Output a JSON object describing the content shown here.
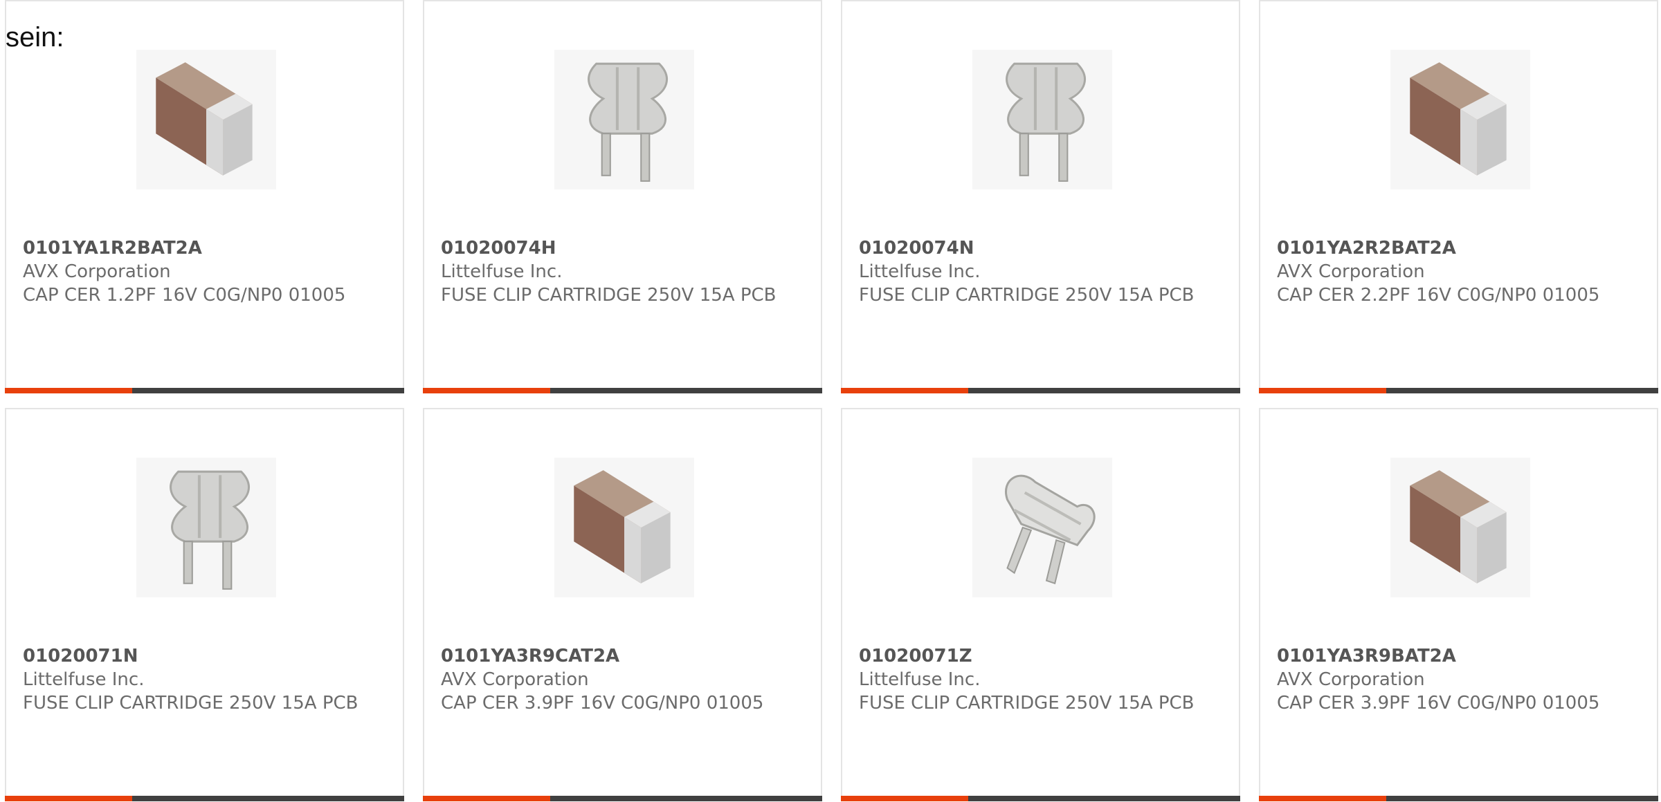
{
  "intro_text": "sein:",
  "colors": {
    "accent": "#e8400c",
    "bar": "#404040",
    "border": "#e4e4e4",
    "text": "#6b6b6b"
  },
  "products": [
    {
      "part_number": "0101YA1R2BAT2A",
      "manufacturer": "AVX Corporation",
      "description": "CAP CER 1.2PF 16V C0G/NP0 01005",
      "image": "ceramic-capacitor-chip"
    },
    {
      "part_number": "01020074H",
      "manufacturer": "Littelfuse Inc.",
      "description": "FUSE CLIP CARTRIDGE 250V 15A PCB",
      "image": "fuse-clip"
    },
    {
      "part_number": "01020074N",
      "manufacturer": "Littelfuse Inc.",
      "description": "FUSE CLIP CARTRIDGE 250V 15A PCB",
      "image": "fuse-clip"
    },
    {
      "part_number": "0101YA2R2BAT2A",
      "manufacturer": "AVX Corporation",
      "description": "CAP CER 2.2PF 16V C0G/NP0 01005",
      "image": "ceramic-capacitor-chip"
    },
    {
      "part_number": "01020071N",
      "manufacturer": "Littelfuse Inc.",
      "description": "FUSE CLIP CARTRIDGE 250V 15A PCB",
      "image": "fuse-clip"
    },
    {
      "part_number": "0101YA3R9CAT2A",
      "manufacturer": "AVX Corporation",
      "description": "CAP CER 3.9PF 16V C0G/NP0 01005",
      "image": "ceramic-capacitor-chip"
    },
    {
      "part_number": "01020071Z",
      "manufacturer": "Littelfuse Inc.",
      "description": "FUSE CLIP CARTRIDGE 250V 15A PCB",
      "image": "fuse-clip-angled"
    },
    {
      "part_number": "0101YA3R9BAT2A",
      "manufacturer": "AVX Corporation",
      "description": "CAP CER 3.9PF 16V C0G/NP0 01005",
      "image": "ceramic-capacitor-chip"
    }
  ]
}
